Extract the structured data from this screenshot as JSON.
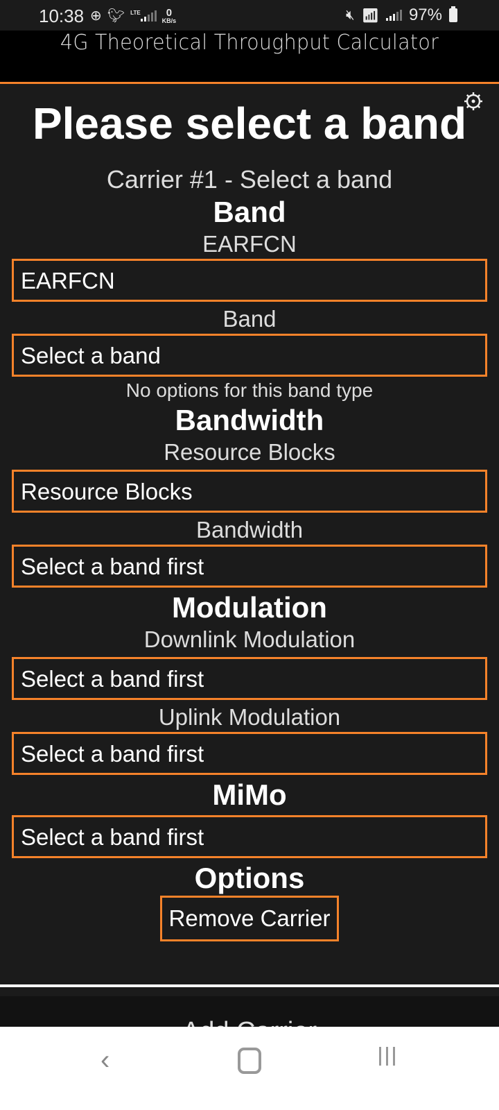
{
  "status_bar": {
    "time": "10:38",
    "network_type": "LTE",
    "data_rate_value": "0",
    "data_rate_unit": "KB/s",
    "battery": "97%",
    "icons": [
      "chat-plus-icon",
      "twitter-icon",
      "lte-signal-icon",
      "mute-icon",
      "wifi-icon",
      "signal-icon",
      "battery-icon"
    ]
  },
  "app": {
    "title": "4G Theoretical Throughput Calculator",
    "accent_color": "#f5822a"
  },
  "main": {
    "page_title": "Please select a band",
    "settings_icon": "gear-icon",
    "carrier_title": "Carrier #1 - Select a band",
    "band_section": {
      "heading": "Band",
      "earfcn_label": "EARFCN",
      "earfcn_placeholder": "EARFCN",
      "band_label": "Band",
      "band_value": "Select a band",
      "band_note": "No options for this band type"
    },
    "bandwidth_section": {
      "heading": "Bandwidth",
      "rb_label": "Resource Blocks",
      "rb_placeholder": "Resource Blocks",
      "bandwidth_label": "Bandwidth",
      "bandwidth_value": "Select a band first"
    },
    "modulation_section": {
      "heading": "Modulation",
      "dl_label": "Downlink Modulation",
      "dl_value": "Select a band first",
      "ul_label": "Uplink Modulation",
      "ul_value": "Select a band first"
    },
    "mimo_section": {
      "heading": "MiMo",
      "mimo_value": "Select a band first"
    },
    "options_section": {
      "heading": "Options",
      "remove_button": "Remove Carrier"
    }
  },
  "footer": {
    "add_carrier": "Add Carrier"
  }
}
